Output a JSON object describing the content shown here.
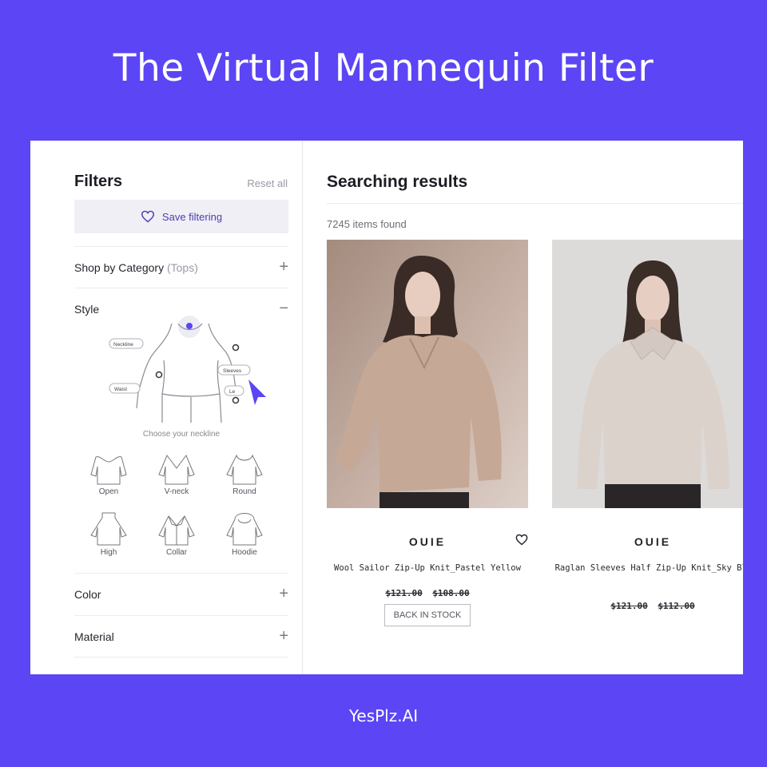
{
  "headline": "The Virtual Mannequin Filter",
  "footer": "YesPlz.AI",
  "colors": {
    "background": "#5b45f5",
    "accent": "#5b45f5",
    "panel": "#ffffff"
  },
  "filters": {
    "title": "Filters",
    "reset_label": "Reset all",
    "save_label": "Save filtering",
    "save_icon": "heart-outline-icon",
    "category": {
      "label": "Shop by Category",
      "value": "(Tops)",
      "toggle": "+"
    },
    "style": {
      "label": "Style",
      "toggle": "−",
      "mannequin_tags": [
        "Neckline",
        "Sleeves",
        "Waist",
        "Le"
      ],
      "caption": "Choose your neckline",
      "necklines": [
        "Open",
        "V-neck",
        "Round",
        "High",
        "Collar",
        "Hoodie"
      ]
    },
    "color": {
      "label": "Color",
      "toggle": "+"
    },
    "material": {
      "label": "Material",
      "toggle": "+"
    }
  },
  "results": {
    "title": "Searching results",
    "count": "7245 items found",
    "products": [
      {
        "brand": "OUIE",
        "name": "Wool Sailor Zip-Up Knit_Pastel Yellow",
        "price_original": "$121.00",
        "price_sale": "$108.00",
        "action": "BACK IN STOCK",
        "sweater_color": "#c5a896"
      },
      {
        "brand": "OUIE",
        "name": "Raglan Sleeves Half Zip-Up Knit_Sky Blue",
        "price_original": "$121.00",
        "price_sale": "$112.00",
        "sweater_color": "#dcd2cc"
      }
    ]
  }
}
